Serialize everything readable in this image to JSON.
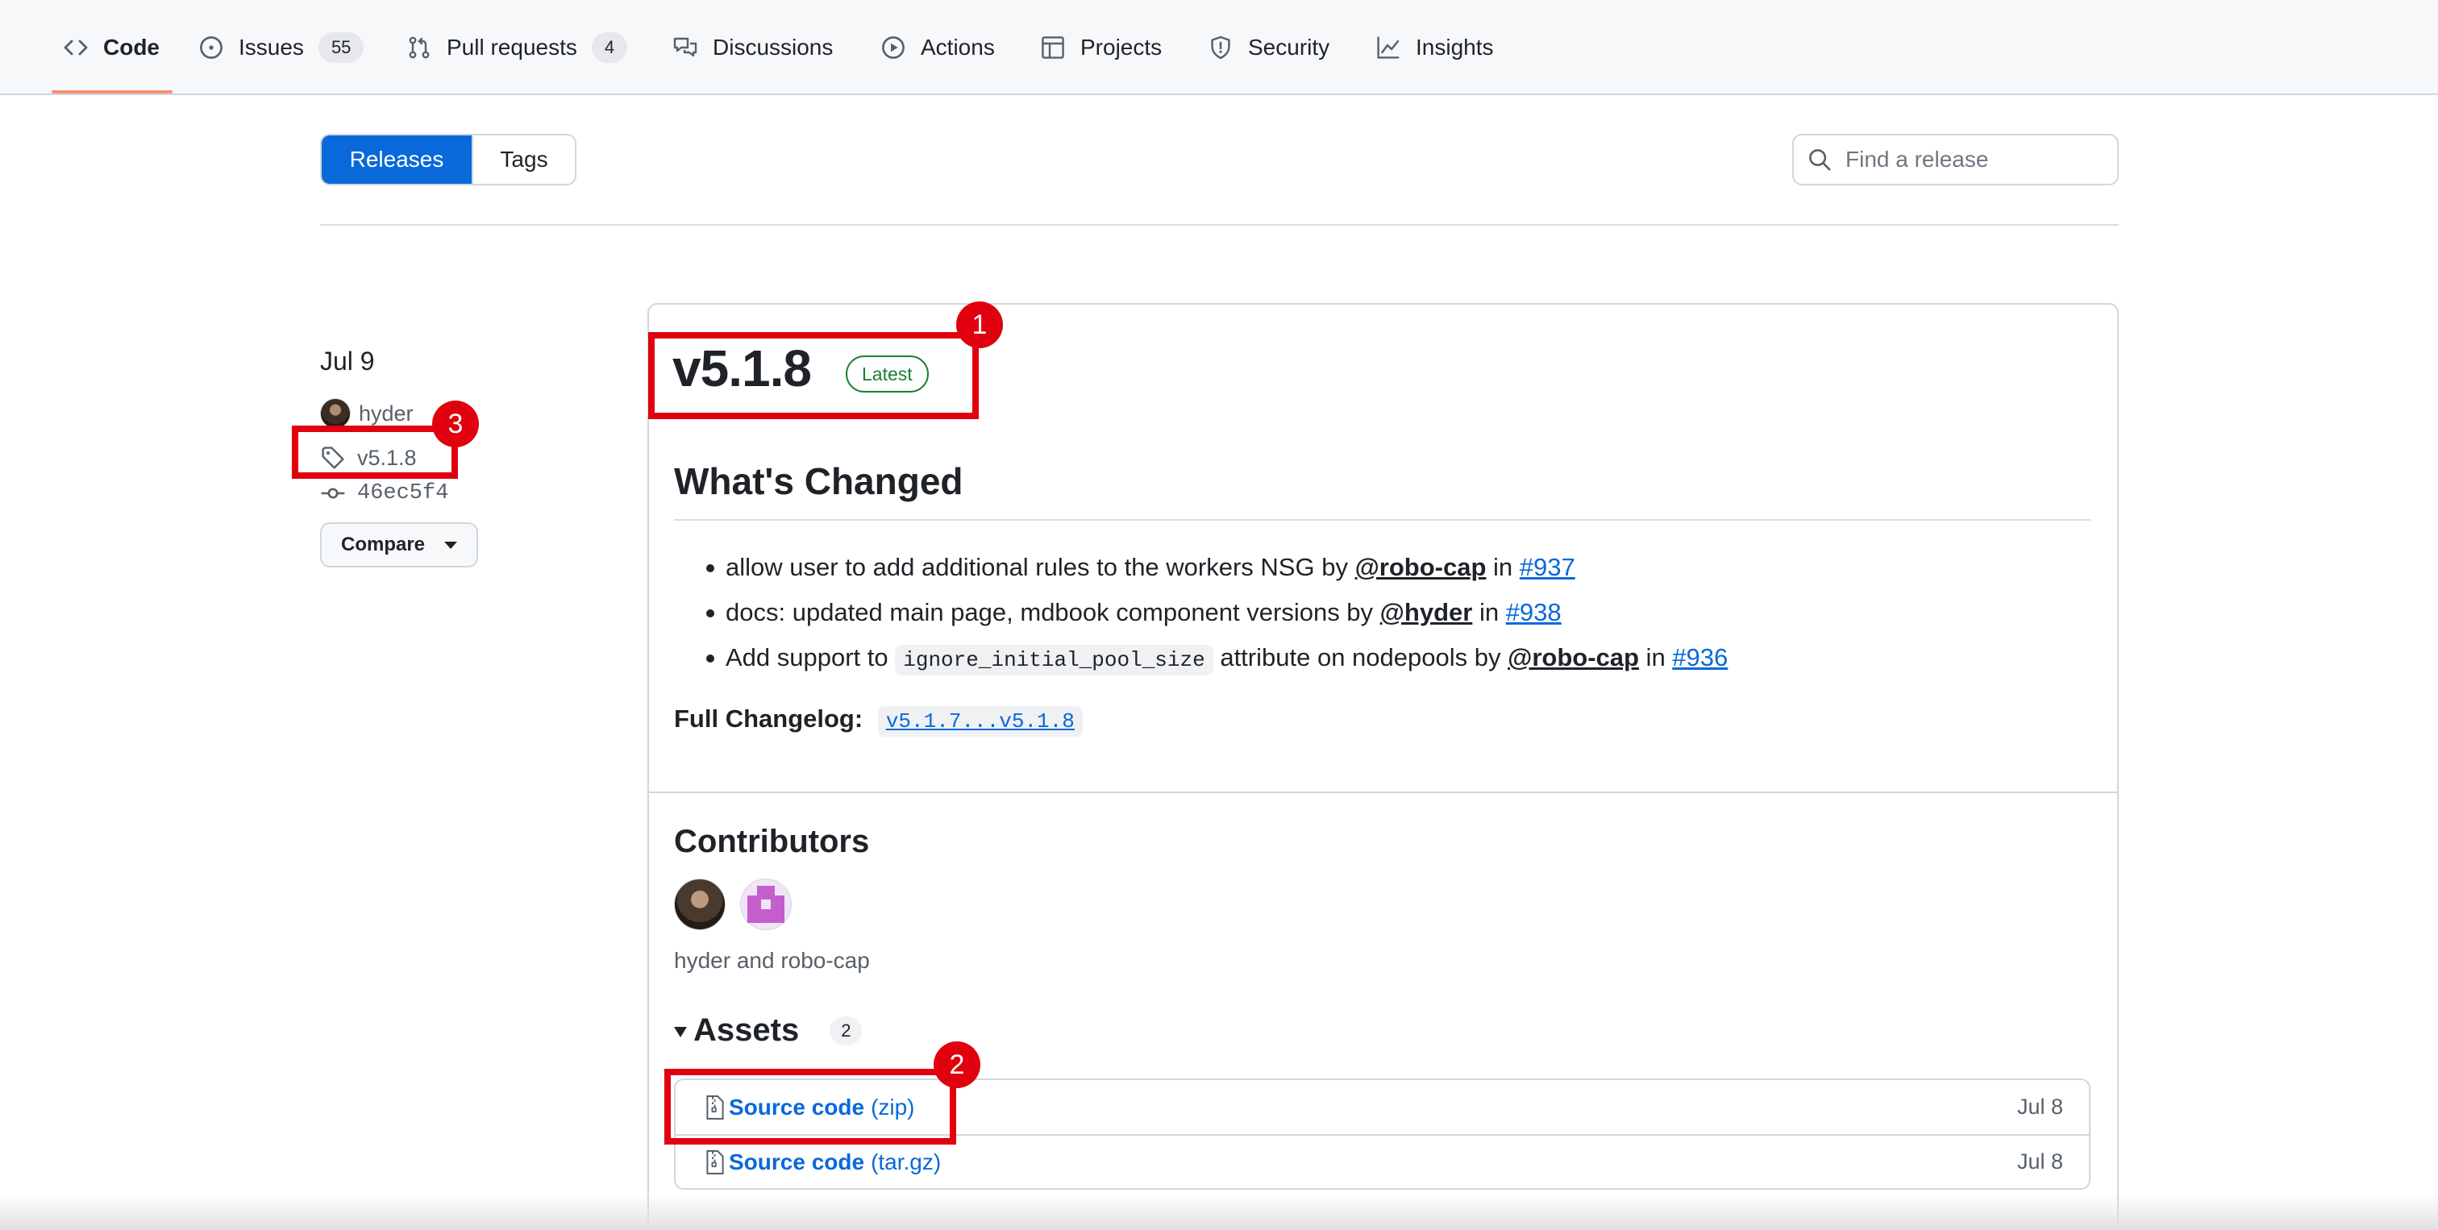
{
  "nav": {
    "items": [
      {
        "label": "Code",
        "icon": "code-icon",
        "selected": true
      },
      {
        "label": "Issues",
        "icon": "issue-opened-icon",
        "count": "55"
      },
      {
        "label": "Pull requests",
        "icon": "git-pull-request-icon",
        "count": "4"
      },
      {
        "label": "Discussions",
        "icon": "comment-discussion-icon"
      },
      {
        "label": "Actions",
        "icon": "play-icon"
      },
      {
        "label": "Projects",
        "icon": "table-icon"
      },
      {
        "label": "Security",
        "icon": "shield-icon"
      },
      {
        "label": "Insights",
        "icon": "graph-icon"
      }
    ]
  },
  "subnav": {
    "releases_label": "Releases",
    "tags_label": "Tags",
    "search_placeholder": "Find a release"
  },
  "meta": {
    "date": "Jul 9",
    "author": "hyder",
    "tag": "v5.1.8",
    "commit": "46ec5f4",
    "compare_label": "Compare"
  },
  "release": {
    "title": "v5.1.8",
    "badge": "Latest",
    "whats_changed_heading": "What's Changed",
    "changes": [
      {
        "text": "allow user to add additional rules to the workers NSG by ",
        "mention": "@robo-cap",
        "in": " in ",
        "pr": "#937"
      },
      {
        "text": "docs: updated main page, mdbook component versions by ",
        "mention": "@hyder",
        "in": " in ",
        "pr": "#938"
      },
      {
        "text_before": "Add support to ",
        "code": "ignore_initial_pool_size",
        "text_after": " attribute on nodepools by ",
        "mention": "@robo-cap",
        "in": " in ",
        "pr": "#936"
      }
    ],
    "changelog_label": "Full Changelog:",
    "changelog_link": "v5.1.7...v5.1.8",
    "contributors_heading": "Contributors",
    "contributors_names": "hyder and robo-cap",
    "assets_heading": "Assets",
    "assets_count": "2",
    "assets": [
      {
        "name": "Source code",
        "kind": "(zip)",
        "date": "Jul 8"
      },
      {
        "name": "Source code",
        "kind": "(tar.gz)",
        "date": "Jul 8"
      }
    ]
  },
  "annotations": [
    "1",
    "2",
    "3"
  ],
  "colors": {
    "accent": "#0969da",
    "success": "#1a7f37",
    "annotation": "#e0000e",
    "nav_underline": "#fd8c73"
  }
}
